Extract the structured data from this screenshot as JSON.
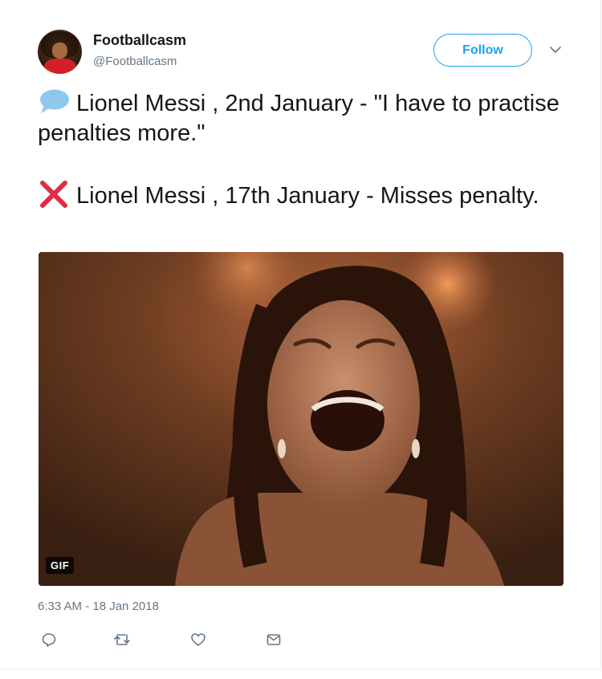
{
  "author": {
    "name": "Footballcasm",
    "handle": "@Footballcasm"
  },
  "follow_button": {
    "label": "Follow"
  },
  "tweet": {
    "line1_text": "Lionel Messi , 2nd January - \"I have to practise penalties more.\"",
    "line1_icon": "speech-bubble-icon",
    "line2_text": "Lionel Messi , 17th January - Misses penalty.",
    "line2_icon": "cross-mark-icon"
  },
  "media": {
    "badge": "GIF"
  },
  "timestamp": "6:33 AM - 18 Jan 2018",
  "actions": [
    "reply-icon",
    "retweet-icon",
    "like-icon",
    "message-icon"
  ],
  "colors": {
    "accent": "#1da1f2",
    "text": "#14171a",
    "muted": "#657786",
    "cross": "#dd2e44",
    "bubble": "#8fc8ef"
  }
}
